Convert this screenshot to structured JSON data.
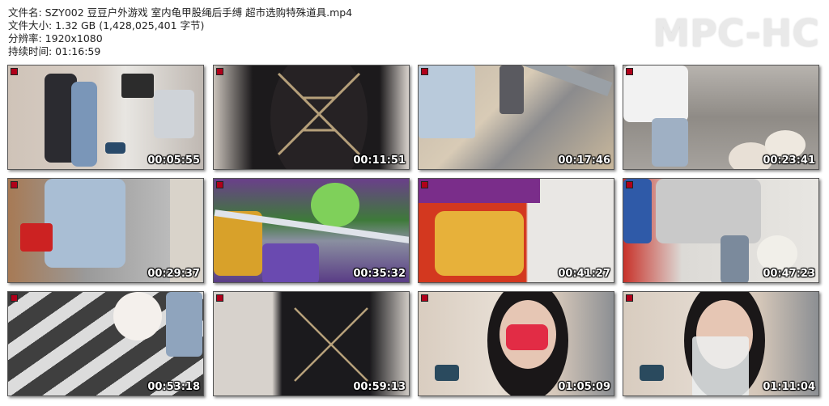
{
  "file_info": {
    "name_line": "文件名: SZY002 豆豆户外游戏 室内龟甲股绳后手缚 超市选购特殊道具.mp4",
    "size_line": "文件大小: 1.32 GB (1,428,025,401 字节)",
    "resolution_line": "分辨率: 1920x1080",
    "duration_line": "持续时间: 01:16:59"
  },
  "logo_text": "MPC-HC",
  "thumbnails": [
    {
      "timestamp": "00:05:55"
    },
    {
      "timestamp": "00:11:51"
    },
    {
      "timestamp": "00:17:46"
    },
    {
      "timestamp": "00:23:41"
    },
    {
      "timestamp": "00:29:37"
    },
    {
      "timestamp": "00:35:32"
    },
    {
      "timestamp": "00:41:27"
    },
    {
      "timestamp": "00:47:23"
    },
    {
      "timestamp": "00:53:18"
    },
    {
      "timestamp": "00:59:13"
    },
    {
      "timestamp": "01:05:09"
    },
    {
      "timestamp": "01:11:04"
    }
  ],
  "colors": {
    "marker": "#b0001a",
    "timestamp_text": "#ffffff"
  }
}
